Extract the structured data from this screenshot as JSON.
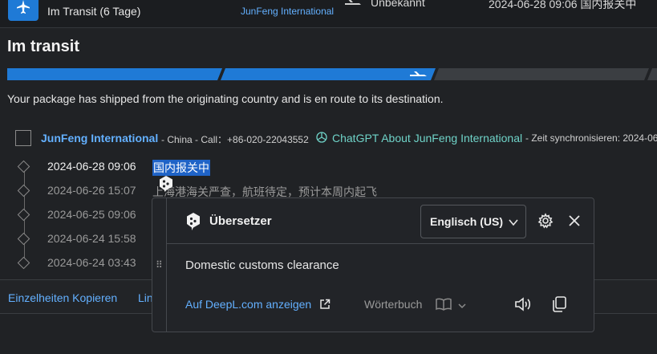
{
  "topbar": {
    "status": "Im Transit (6 Tage)",
    "carrier": "JunFeng International",
    "destination": "Unbekannt",
    "last_event": "2024-06-28 09:06  国内报关中"
  },
  "section": {
    "title": "Im transit",
    "description": "Your package has shipped from the originating country and is en route to its destination.",
    "progress_step": 2,
    "progress_total": 4
  },
  "carrier_row": {
    "name": "JunFeng International",
    "meta": "- China - Call：+86-020-22043552",
    "chatgpt_link": "ChatGPT About JunFeng International",
    "sync": "- Zeit synchronisieren: 2024-06"
  },
  "events": [
    {
      "date": "2024-06-28 09:06",
      "text": "国内报关中"
    },
    {
      "date": "2024-06-26 15:07",
      "text": "上海港海关严查，航班待定，预计本周内起飞"
    },
    {
      "date": "2024-06-25 09:06",
      "text": ""
    },
    {
      "date": "2024-06-24 15:58",
      "text": ""
    },
    {
      "date": "2024-06-24 03:43",
      "text": ""
    }
  ],
  "footer": {
    "copy_details": "Einzelheiten Kopieren",
    "link_partial": "Lin"
  },
  "translator": {
    "title": "Übersetzer",
    "language": "Englisch (US)",
    "translation": "Domestic customs clearance",
    "deepl_link": "Auf DeepL.com anzeigen",
    "dictionary": "Wörterbuch"
  },
  "colors": {
    "accent": "#1f7ad6",
    "link": "#63b0ff",
    "highlight": "#1f63c7",
    "chatgpt": "#6fd3c8",
    "background": "#202225"
  },
  "icons": [
    "airplane-icon",
    "arrival-plane-icon",
    "chatgpt-icon",
    "deepl-icon",
    "chevron-down-icon",
    "gear-icon",
    "close-icon",
    "external-link-icon",
    "book-icon",
    "speaker-icon",
    "copy-icon",
    "drag-grip-icon"
  ]
}
